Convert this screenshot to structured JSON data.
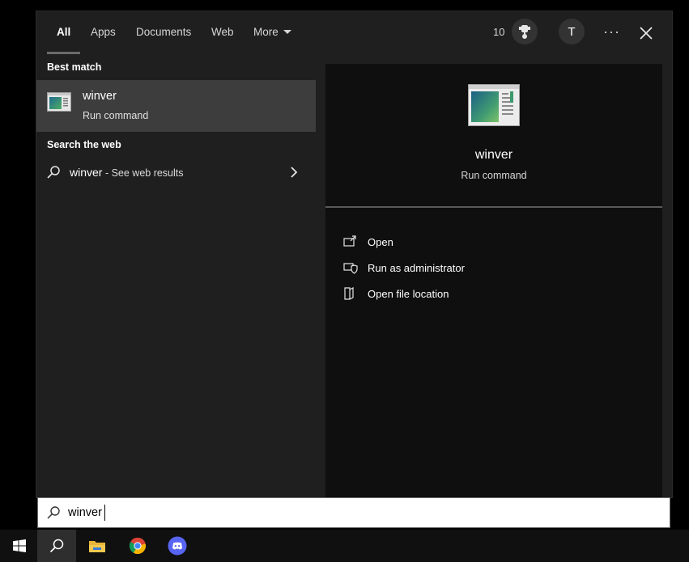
{
  "tabs": [
    {
      "label": "All",
      "active": true
    },
    {
      "label": "Apps"
    },
    {
      "label": "Documents"
    },
    {
      "label": "Web"
    },
    {
      "label": "More"
    }
  ],
  "header": {
    "points": "10",
    "avatar_letter": "T",
    "more_options": "···",
    "icons": [
      "rewards-trophy-icon",
      "more-options-icon",
      "close-icon"
    ]
  },
  "left": {
    "best_match_label": "Best match",
    "best_match": {
      "title": "winver",
      "subtitle": "Run command"
    },
    "search_web_label": "Search the web",
    "web_result": {
      "query": "winver",
      "suffix": " - See web results"
    }
  },
  "right": {
    "title": "winver",
    "subtitle": "Run command",
    "actions": [
      {
        "label": "Open",
        "icon": "open-icon"
      },
      {
        "label": "Run as administrator",
        "icon": "shield-icon"
      },
      {
        "label": "Open file location",
        "icon": "file-location-icon"
      }
    ]
  },
  "search": {
    "value": "winver"
  },
  "taskbar": {
    "items": [
      "windows-start-icon",
      "search-icon",
      "file-explorer-icon",
      "chrome-icon",
      "discord-icon"
    ]
  },
  "colors": {
    "panel_bg": "#1f1f1f",
    "selected_bg": "#3d3d3d",
    "preview_bg": "#0f0f0f",
    "discord": "#5865f2"
  }
}
